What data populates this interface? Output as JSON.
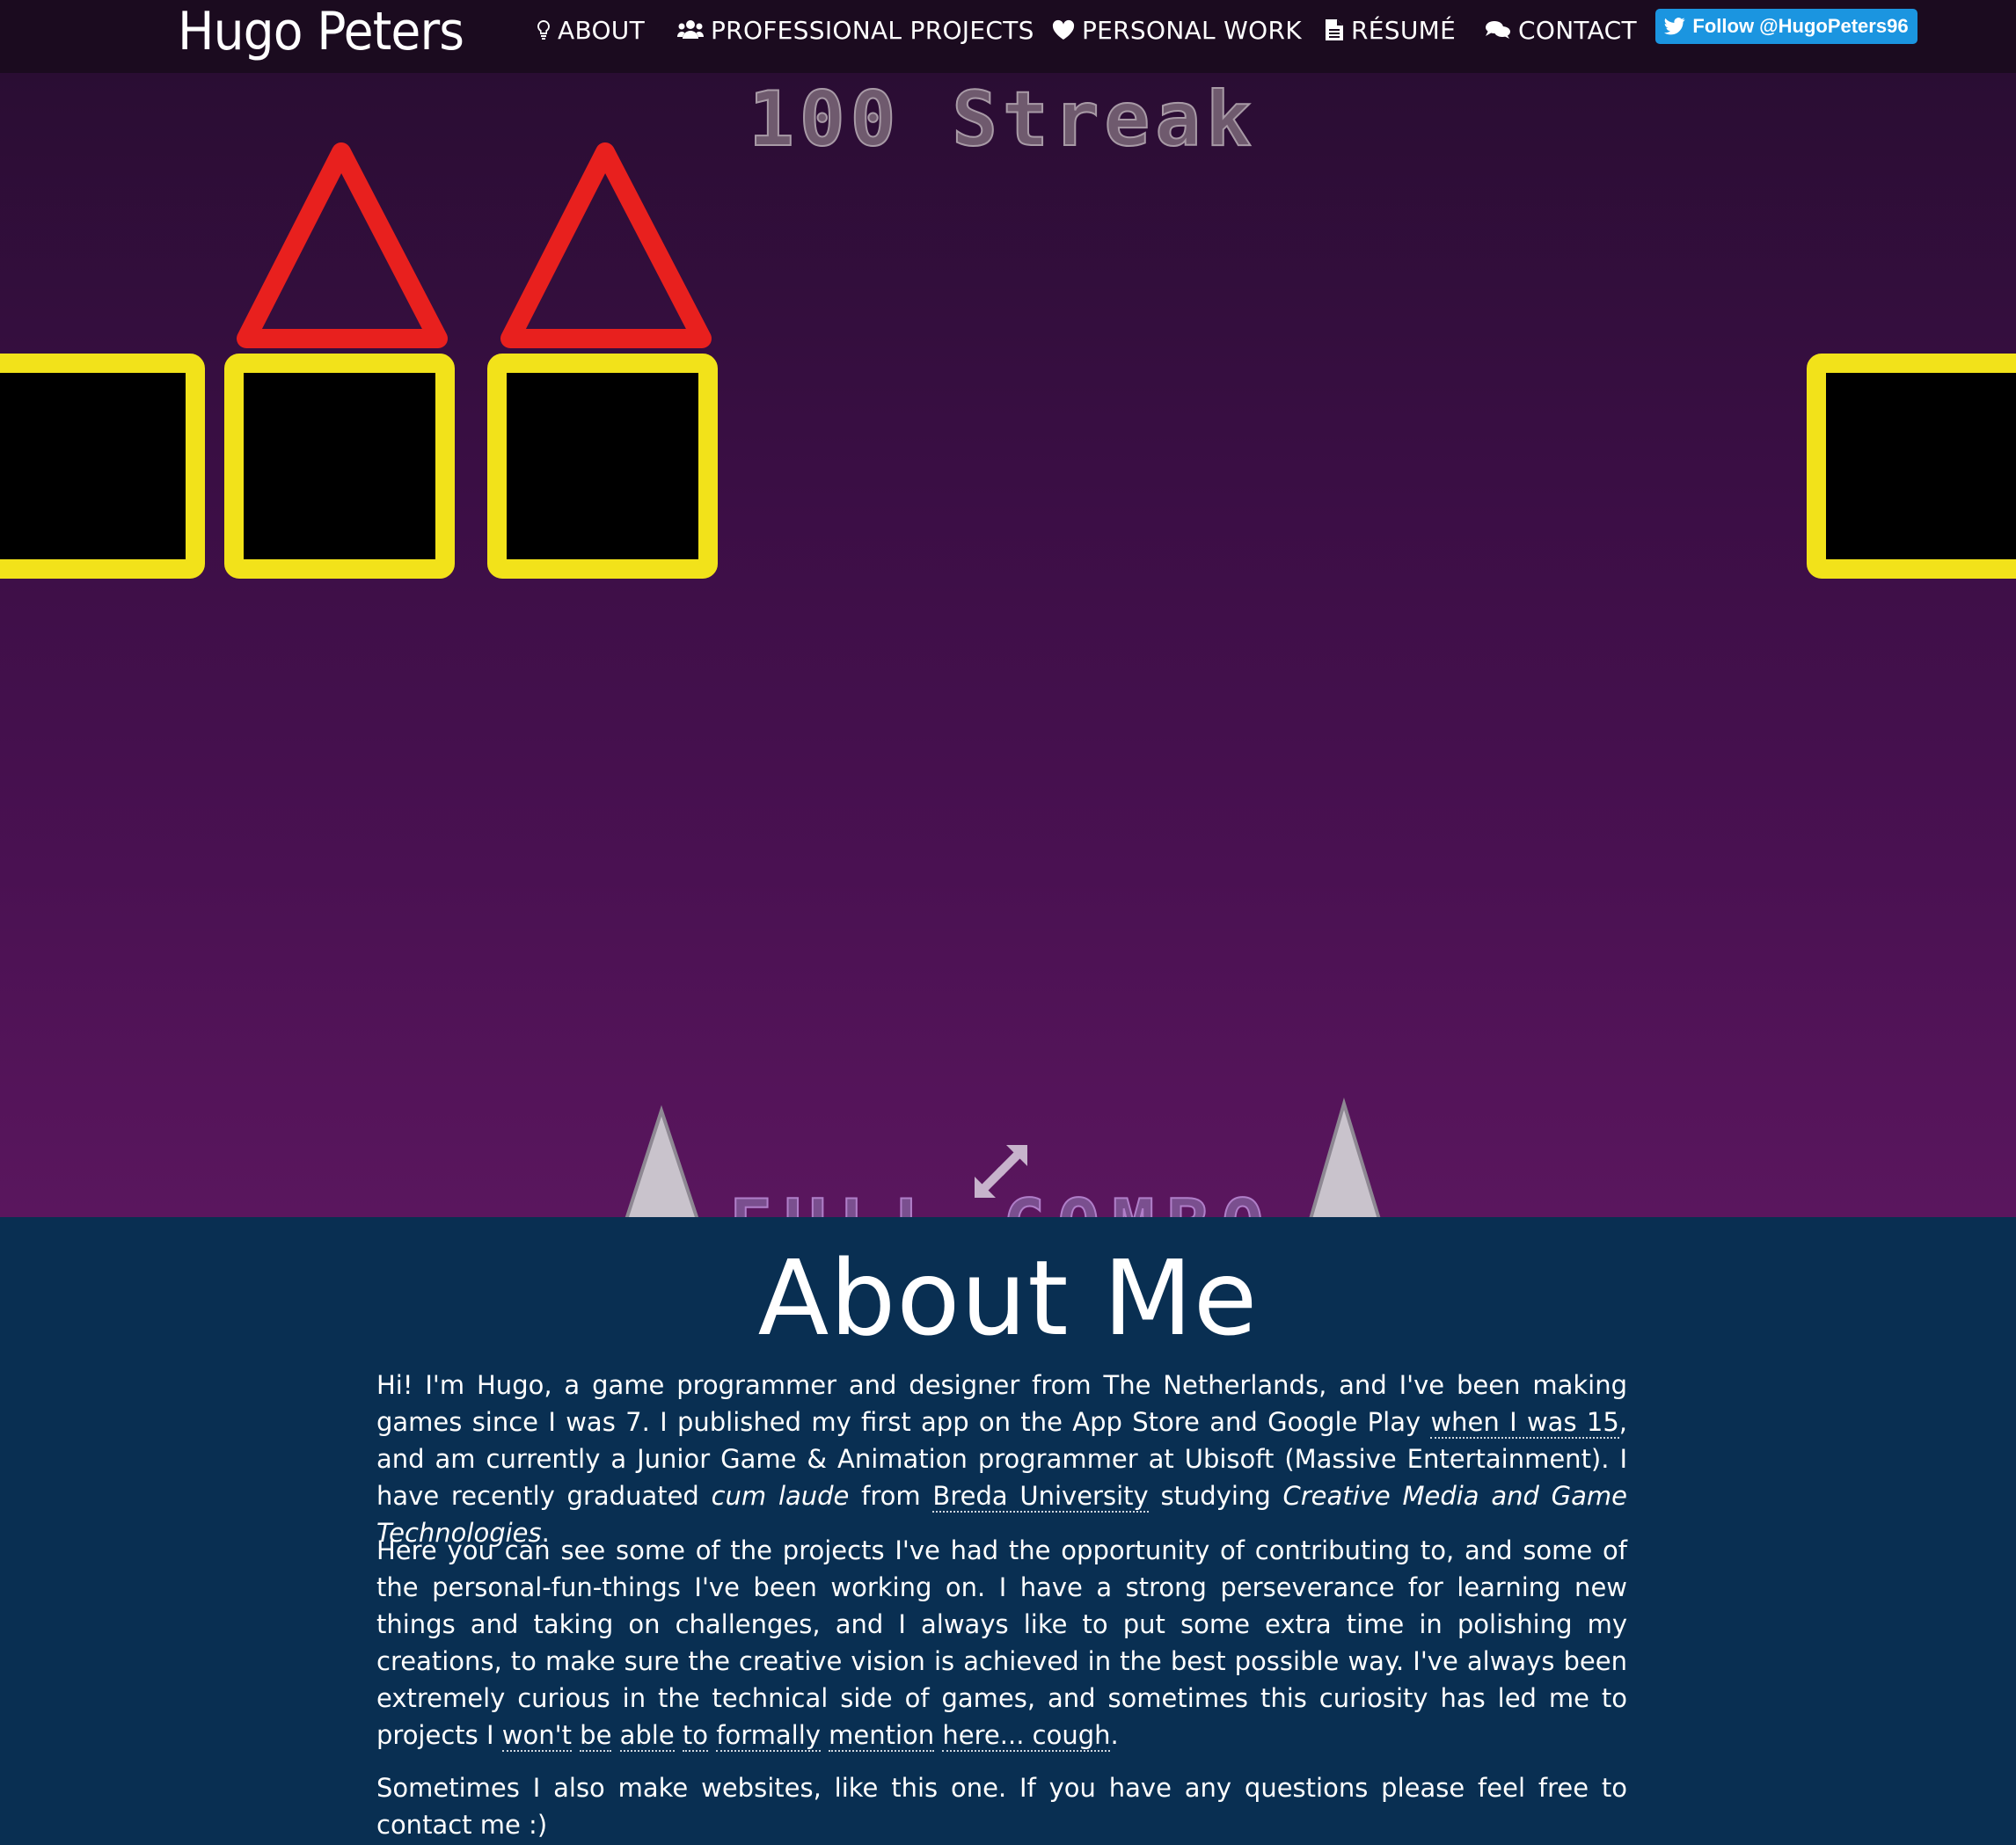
{
  "navbar": {
    "brand": "Hugo Peters",
    "items": [
      {
        "label": "ABOUT",
        "icon": "lightbulb-icon"
      },
      {
        "label": "PROFESSIONAL PROJECTS",
        "icon": "users-icon"
      },
      {
        "label": "PERSONAL WORK",
        "icon": "heart-icon"
      },
      {
        "label": "RÉSUMÉ",
        "icon": "document-icon"
      },
      {
        "label": "CONTACT",
        "icon": "chat-bubbles-icon"
      }
    ],
    "twitter_button": "Follow @HugoPeters96"
  },
  "hero": {
    "game_text_top": "100 Streak",
    "game_text_bottom": "FULL COMBO",
    "colors": {
      "background": "#3a0e44",
      "squares": "#f2e21a",
      "triangles": "#e8201e"
    },
    "fullscreen_icon": "expand-arrows-icon"
  },
  "about": {
    "title": "About Me",
    "p1": {
      "t1": "Hi! I'm Hugo, a game programmer and designer from The Netherlands, and I've been making games since I was 7. I published my first app on the App Store and Google Play ",
      "link1": "when I was 15",
      "t2": ", and am currently a Junior Game & Animation programmer at Ubisoft (Massive Entertainment). I have recently graduated ",
      "em1": "cum laude",
      "t3": " from ",
      "link2": "Breda University",
      "t4": " studying ",
      "em2": "Creative Media and Game Technologies",
      "t5": "."
    },
    "p2": {
      "t1": "Here you can see some of the projects I've had the opportunity of contributing to, and some of the personal-fun-things I've been working on. I have a strong perseverance for learning new things and taking on challenges, and I always like to put some extra time in polishing my creations, to make sure the creative vision is achieved in the best possible way. I've always been extremely curious in the technical side of games, and sometimes this curiosity has led me to projects I ",
      "links": [
        "won't",
        "be",
        "able",
        "to",
        "formally",
        "mention",
        "here... cough"
      ],
      "t2": "."
    },
    "p3": "Sometimes I also make websites, like this one. If you have any questions please feel free to contact me :)"
  }
}
